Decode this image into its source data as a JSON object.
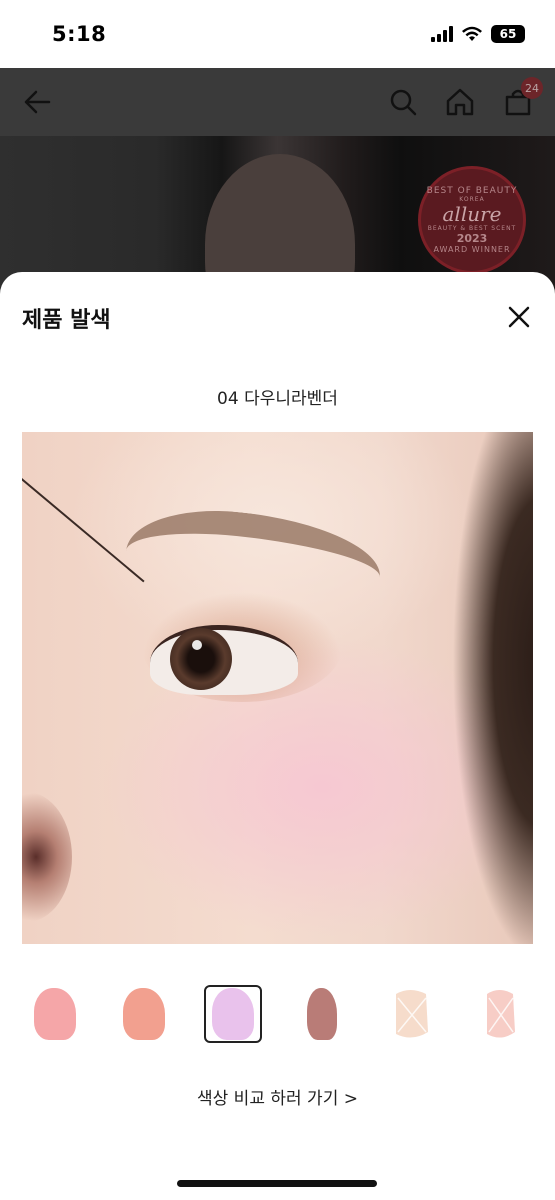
{
  "status_bar": {
    "time": "5:18",
    "battery": "65"
  },
  "header": {
    "back_icon": "arrow-left-icon",
    "search_icon": "search-icon",
    "home_icon": "home-icon",
    "cart_icon": "shopping-bag-icon",
    "cart_count": "24"
  },
  "hero": {
    "badge_top": "BEST OF BEAUTY",
    "badge_country": "KOREA",
    "badge_brand": "allure",
    "badge_sub": "BEAUTY & BEST SCENT",
    "badge_year": "2023",
    "badge_bottom": "AWARD WINNER"
  },
  "sheet": {
    "title": "제품 발색",
    "close_icon": "close-icon",
    "shade_name": "04 다우니라벤더",
    "swatches": [
      {
        "color": "#f5a6a8",
        "selected": false
      },
      {
        "color": "#f2a08f",
        "selected": false
      },
      {
        "color": "#e9c2ec",
        "selected": true
      },
      {
        "color": "#b97c77",
        "selected": false
      },
      {
        "color": "#f6dccb",
        "selected": false
      },
      {
        "color": "#f7cdc6",
        "selected": false
      }
    ],
    "compare_link": "색상 비교 하러 가기 >"
  },
  "colors": {
    "overlay_header": "#3a3a3a",
    "badge": "#6d2529",
    "accent_text": "#222222"
  }
}
